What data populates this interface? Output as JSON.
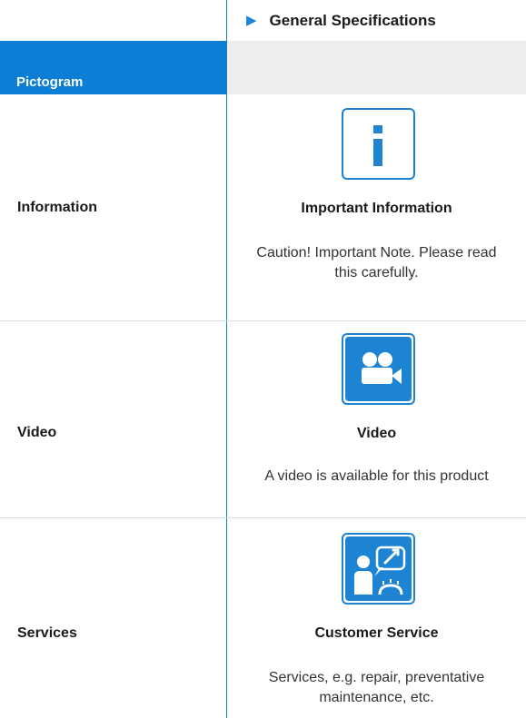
{
  "header": {
    "title": "General Specifications",
    "column_label": "Pictogram"
  },
  "rows": [
    {
      "label": "Information",
      "icon": "info-icon",
      "title": "Important Information",
      "description": "Caution! Important Note. Please read this carefully."
    },
    {
      "label": "Video",
      "icon": "video-camera-icon",
      "title": "Video",
      "description": "A video is available for this product"
    },
    {
      "label": "Services",
      "icon": "customer-service-icon",
      "title": "Customer Service",
      "description": "Services, e.g. repair, preventative maintenance, etc."
    }
  ],
  "colors": {
    "accent": "#0c7ed6",
    "header_gray": "#ededed"
  }
}
